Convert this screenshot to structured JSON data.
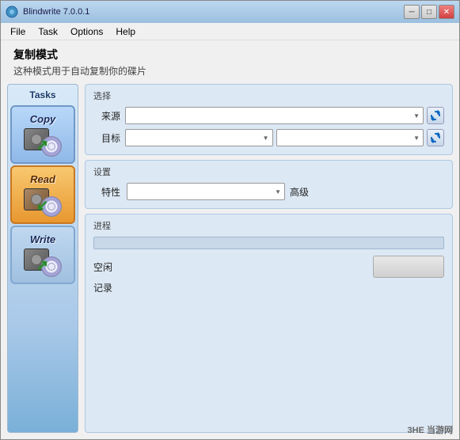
{
  "window": {
    "title": "Blindwrite 7.0.0.1",
    "minimize_label": "─",
    "maximize_label": "□",
    "close_label": "✕"
  },
  "menu": {
    "items": [
      "File",
      "Task",
      "Options",
      "Help"
    ]
  },
  "page": {
    "title": "复制模式",
    "subtitle": "这种模式用于自动复制你的碟片"
  },
  "sidebar": {
    "title": "Tasks",
    "tasks": [
      {
        "id": "copy",
        "label": "Copy"
      },
      {
        "id": "read",
        "label": "Read"
      },
      {
        "id": "write",
        "label": "Write"
      }
    ]
  },
  "selection": {
    "legend": "选择",
    "source_label": "来源",
    "target_label": "目标",
    "source_placeholder": "",
    "target_placeholder": "",
    "target2_placeholder": ""
  },
  "settings": {
    "legend": "设置",
    "property_label": "特性",
    "advanced_label": "高级",
    "property_placeholder": ""
  },
  "progress": {
    "legend": "进程",
    "idle_label": "空闲",
    "log_label": "记录",
    "bar_percent": 0
  },
  "watermark": "3HE 当游网"
}
